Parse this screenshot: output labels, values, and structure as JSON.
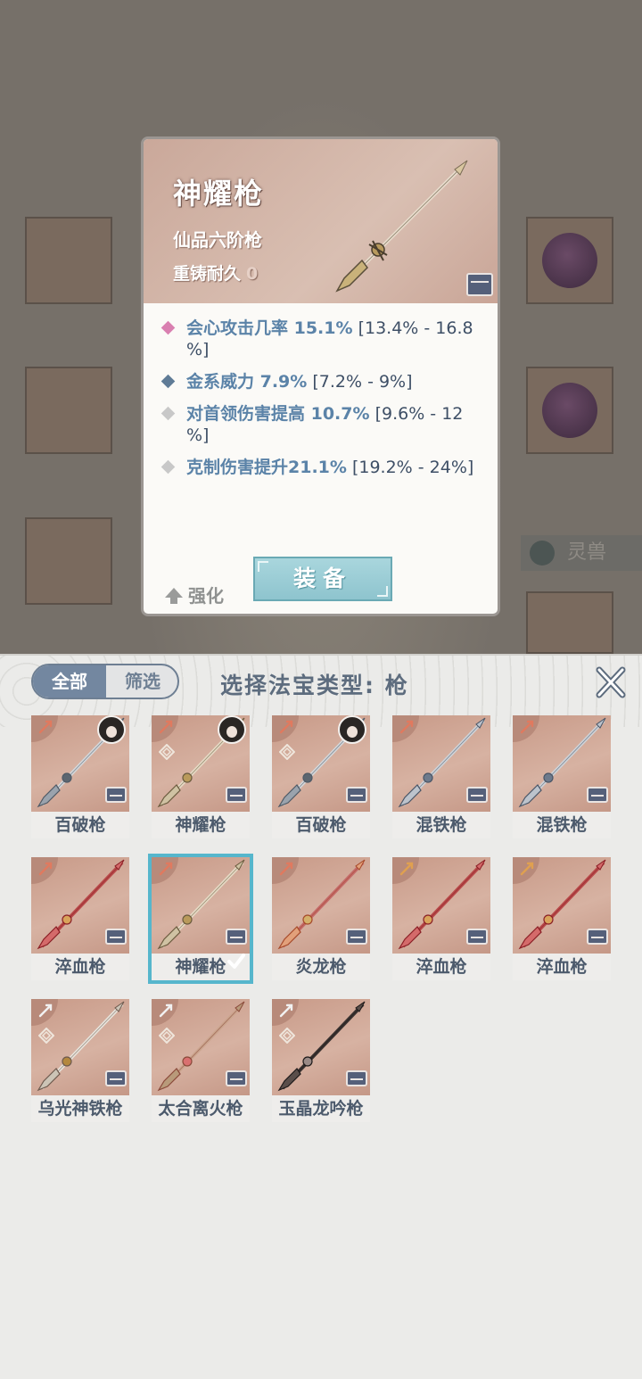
{
  "background": {
    "tab_label": "灵兽"
  },
  "detail": {
    "name": "神耀枪",
    "grade": "仙品六阶枪",
    "durability_label": "重铸耐久",
    "durability_value": "0",
    "stats": [
      {
        "diamond_color": "#d97fb0",
        "line1_name": "会心攻击几率 15.1%",
        "line1_range": " [13.4% - 16.8",
        "line2": "%]"
      },
      {
        "diamond_color": "#5f7b96",
        "line1_name": "金系威力 7.9%",
        "line1_range": " [7.2% - 9%]",
        "line2": ""
      },
      {
        "diamond_color": "#c8c8c8",
        "line1_name": "对首领伤害提高 10.7%",
        "line1_range": " [9.6% - 12",
        "line2": "%]"
      },
      {
        "diamond_color": "#c8c8c8",
        "line1_name": "克制伤害提升21.1%",
        "line1_range": " [19.2% - 24%]",
        "line2": ""
      }
    ],
    "enhance_label": "强化",
    "equip_label": "装备"
  },
  "panel": {
    "tab_all": "全部",
    "tab_filter": "筛选",
    "title": "选择法宝类型: 枪",
    "items": [
      {
        "name": "百破枪",
        "rank_color": "#e07a5f",
        "owner": true,
        "symbol": false,
        "style": "silver"
      },
      {
        "name": "神耀枪",
        "rank_color": "#e07a5f",
        "owner": true,
        "symbol": true,
        "style": "gold"
      },
      {
        "name": "百破枪",
        "rank_color": "#e07a5f",
        "owner": true,
        "symbol": true,
        "style": "silver"
      },
      {
        "name": "混铁枪",
        "rank_color": "#e07a5f",
        "owner": false,
        "symbol": false,
        "style": "steel"
      },
      {
        "name": "混铁枪",
        "rank_color": "#e07a5f",
        "owner": false,
        "symbol": false,
        "style": "steel"
      },
      {
        "name": "淬血枪",
        "rank_color": "#e07a5f",
        "owner": false,
        "symbol": false,
        "style": "red"
      },
      {
        "name": "神耀枪",
        "rank_color": "#e07a5f",
        "owner": false,
        "symbol": false,
        "style": "gold",
        "selected": true
      },
      {
        "name": "炎龙枪",
        "rank_color": "#e07a5f",
        "owner": false,
        "symbol": false,
        "style": "flame"
      },
      {
        "name": "淬血枪",
        "rank_color": "#e0a050",
        "owner": false,
        "symbol": false,
        "style": "red"
      },
      {
        "name": "淬血枪",
        "rank_color": "#e0a050",
        "owner": false,
        "symbol": false,
        "style": "red"
      },
      {
        "name": "乌光神铁枪",
        "rank_color": "#f1f1f1",
        "owner": false,
        "symbol": true,
        "style": "ornate"
      },
      {
        "name": "太合离火枪",
        "rank_color": "#f1f1f1",
        "owner": false,
        "symbol": true,
        "style": "flower"
      },
      {
        "name": "玉晶龙吟枪",
        "rank_color": "#f1f1f1",
        "owner": false,
        "symbol": true,
        "style": "dark"
      }
    ]
  },
  "icons": {
    "close": "close-icon",
    "chest": "chest-icon",
    "enhance": "arrow-up-icon",
    "check": "check-icon",
    "rank": "spear-rank-icon"
  }
}
